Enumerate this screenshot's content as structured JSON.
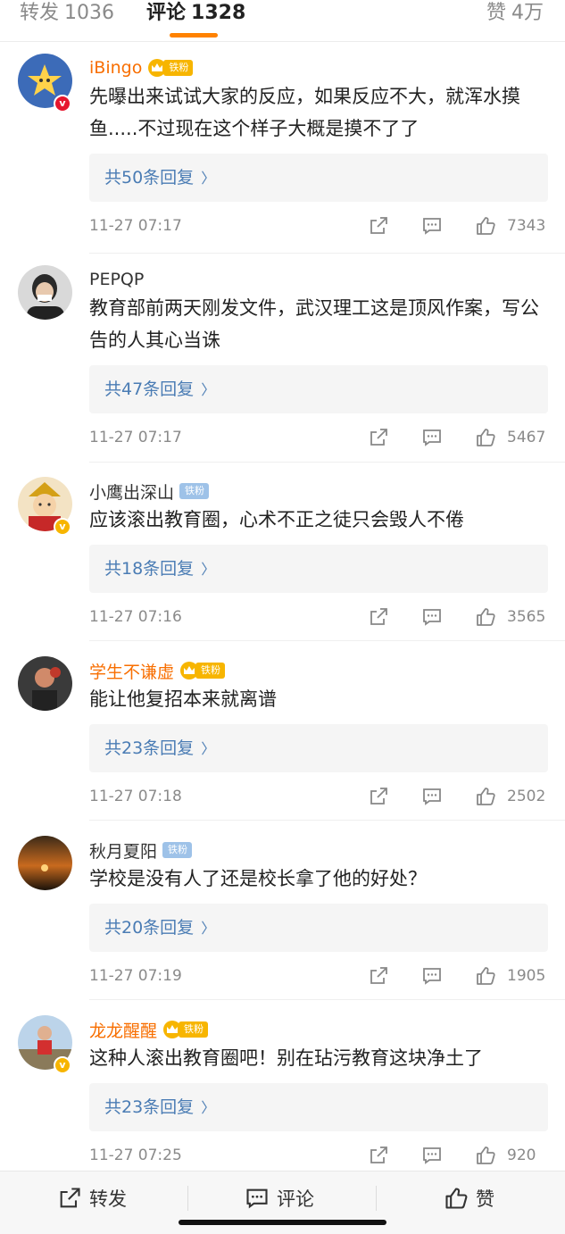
{
  "tabs": {
    "repost_label": "转发",
    "repost_count": "1036",
    "comment_label": "评论",
    "comment_count": "1328",
    "like_label": "赞",
    "like_count": "4万"
  },
  "comments": [
    {
      "name": "iBingo",
      "fan_badge": "铁粉",
      "text": "先曝出来试试大家的反应，如果反应不大，就浑水摸鱼.....不过现在这个样子大概是摸不了了",
      "replies": "共50条回复",
      "time": "11-27 07:17",
      "likes": "7343"
    },
    {
      "name": "PEPQP",
      "fan_badge": "",
      "text": "教育部前两天刚发文件，武汉理工这是顶风作案，写公告的人其心当诛",
      "replies": "共47条回复",
      "time": "11-27 07:17",
      "likes": "5467"
    },
    {
      "name": "小鹰出深山",
      "fan_badge": "铁粉",
      "text": "应该滚出教育圈，心术不正之徒只会毁人不倦",
      "replies": "共18条回复",
      "time": "11-27 07:16",
      "likes": "3565"
    },
    {
      "name": "学生不谦虚",
      "fan_badge": "铁粉",
      "text": "能让他复招本来就离谱",
      "replies": "共23条回复",
      "time": "11-27 07:18",
      "likes": "2502"
    },
    {
      "name": "秋月夏阳",
      "fan_badge": "铁粉",
      "text": "学校是没有人了还是校长拿了他的好处？",
      "replies": "共20条回复",
      "time": "11-27 07:19",
      "likes": "1905"
    },
    {
      "name": "龙龙醒醒",
      "fan_badge": "铁粉",
      "text": "这种人滚出教育圈吧！别在玷污教育这块净土了",
      "replies": "共23条回复",
      "time": "11-27 07:25",
      "likes": "920"
    }
  ],
  "bottom_bar": {
    "repost": "转发",
    "comment": "评论",
    "like": "赞"
  },
  "icons": {
    "share": "share-icon",
    "comment": "comment-icon",
    "like": "thumbs-up-icon",
    "chevron": "chevron-right-icon"
  },
  "colors": {
    "accent": "#ff8200",
    "link": "#4a7cb4",
    "vip_name": "#f86e00"
  }
}
